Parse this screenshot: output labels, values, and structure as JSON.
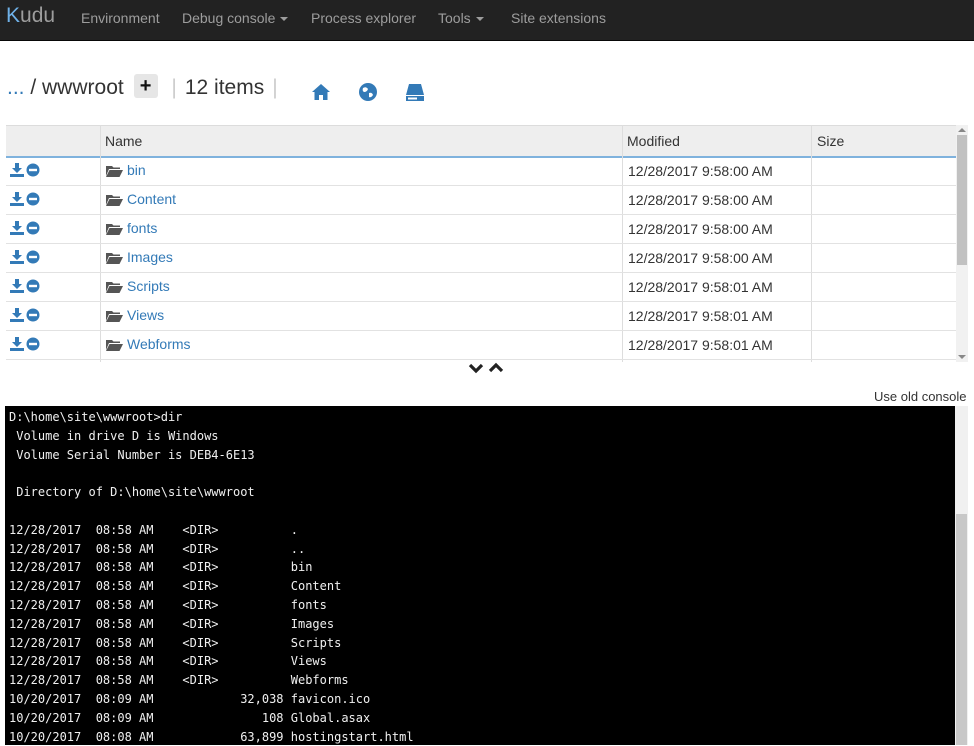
{
  "nav": {
    "brand_initial": "K",
    "brand_rest": "udu",
    "items": [
      {
        "label": "Environment"
      },
      {
        "label": "Debug console"
      },
      {
        "label": "Process explorer"
      },
      {
        "label": "Tools"
      },
      {
        "label": "Site extensions"
      }
    ]
  },
  "breadcrumb": {
    "ellipsis": "...",
    "path": " / wwwroot",
    "add_label": "+",
    "item_count": "12 items"
  },
  "file_table": {
    "columns": {
      "name": "Name",
      "modified": "Modified",
      "size": "Size"
    },
    "rows": [
      {
        "name": "bin",
        "modified": "12/28/2017 9:58:00 AM",
        "size": ""
      },
      {
        "name": "Content",
        "modified": "12/28/2017 9:58:00 AM",
        "size": ""
      },
      {
        "name": "fonts",
        "modified": "12/28/2017 9:58:00 AM",
        "size": ""
      },
      {
        "name": "Images",
        "modified": "12/28/2017 9:58:00 AM",
        "size": ""
      },
      {
        "name": "Scripts",
        "modified": "12/28/2017 9:58:01 AM",
        "size": ""
      },
      {
        "name": "Views",
        "modified": "12/28/2017 9:58:01 AM",
        "size": ""
      },
      {
        "name": "Webforms",
        "modified": "12/28/2017 9:58:01 AM",
        "size": ""
      }
    ]
  },
  "old_console_link": "Use old console",
  "console": {
    "lines": [
      "D:\\home\\site\\wwwroot>dir",
      " Volume in drive D is Windows",
      " Volume Serial Number is DEB4-6E13",
      "",
      " Directory of D:\\home\\site\\wwwroot",
      "",
      "12/28/2017  08:58 AM    <DIR>          .",
      "12/28/2017  08:58 AM    <DIR>          ..",
      "12/28/2017  08:58 AM    <DIR>          bin",
      "12/28/2017  08:58 AM    <DIR>          Content",
      "12/28/2017  08:58 AM    <DIR>          fonts",
      "12/28/2017  08:58 AM    <DIR>          Images",
      "12/28/2017  08:58 AM    <DIR>          Scripts",
      "12/28/2017  08:58 AM    <DIR>          Views",
      "12/28/2017  08:58 AM    <DIR>          Webforms",
      "10/20/2017  08:09 AM            32,038 favicon.ico",
      "10/20/2017  08:09 AM               108 Global.asax",
      "10/20/2017  08:08 AM            63,899 hostingstart.html"
    ]
  },
  "colors": {
    "link": "#337ab7",
    "navbar": "#222222",
    "console_bg": "#000000"
  },
  "icons": {
    "home": "home-icon",
    "globe": "globe-icon",
    "drive": "drive-icon",
    "download": "download-icon",
    "delete": "minus-circle-icon",
    "folder": "folder-open-icon"
  }
}
